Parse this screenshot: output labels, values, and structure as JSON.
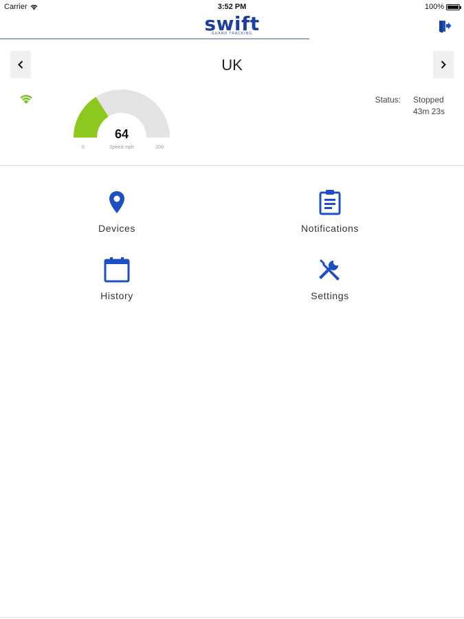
{
  "status_bar": {
    "carrier": "Carrier",
    "time": "3:52 PM",
    "battery": "100%"
  },
  "header": {
    "logo": "swift",
    "logo_sub": "GUARD TRACKING",
    "brand_color": "#1f3fa0"
  },
  "country": {
    "name": "UK",
    "prev_icon": "chevron-left-icon",
    "next_icon": "chevron-right-icon"
  },
  "gauge": {
    "value": "64",
    "label": "Speed mph",
    "min": "0",
    "max": "200",
    "fill_fraction": 0.32,
    "fill_color": "#8dc81f",
    "track_color": "#e3e3e3"
  },
  "status": {
    "label": "Status:",
    "state": "Stopped",
    "duration": "43m 23s"
  },
  "menu": {
    "devices": {
      "label": "Devices",
      "icon": "map-pin-icon"
    },
    "notifications": {
      "label": "Notifications",
      "icon": "clipboard-icon"
    },
    "history": {
      "label": "History",
      "icon": "calendar-icon"
    },
    "settings": {
      "label": "Settings",
      "icon": "tools-icon"
    }
  },
  "icon_color": "#1e4fc2",
  "signal_color": "#7cc22a"
}
